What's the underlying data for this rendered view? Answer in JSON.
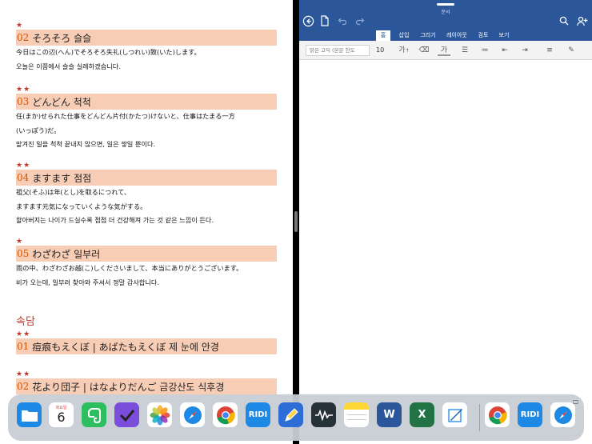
{
  "ebook": {
    "entries": [
      {
        "stars": "★",
        "num": "02",
        "title": "そろそろ 슬슬",
        "lines": [
          "今日はこの辺(へん)でそろそろ失礼(しつれい)致(いた)します。",
          "오늘은 이쯤에서 슬슬 실례하겠습니다."
        ]
      },
      {
        "stars": "★★",
        "num": "03",
        "title": "どんどん 척척",
        "lines": [
          "任(まか)せられた仕事をどんどん片付(かたつ)けないと、仕事はたまる一方",
          "(いっぽう)だ。",
          "맡겨진 일을 척척 끝내지 않으면, 일은 쌓일 뿐이다."
        ]
      },
      {
        "stars": "★★",
        "num": "04",
        "title": "ますます 점점",
        "lines": [
          "祖父(そふ)は年(とし)を取るにつれて、",
          "ますます元気になっていくような気がする。",
          "할아버지는 나이가 드실수록 점점 더 건강해져 가는 것 같은 느낌이 든다."
        ]
      },
      {
        "stars": "★",
        "num": "05",
        "title": "わざわざ 일부러",
        "lines": [
          "雨の中、わざわざお越(こ)しくださいまして、本当にありがとうございます。",
          "비가 오는데, 일부러 찾아와 주셔서 정말 감사합니다."
        ]
      }
    ],
    "section_title": "속담",
    "proverbs": [
      {
        "stars": "★★",
        "num": "01",
        "title": "痘痕もえくぼ | あばたもえくぼ 제 눈에 안경"
      },
      {
        "stars": "★★",
        "num": "02",
        "title": "花より団子 | はなよりだんご 금강산도 식후경"
      }
    ]
  },
  "word": {
    "doc_title": "문서",
    "tabs": [
      "홈",
      "삽입",
      "그리기",
      "레이아웃",
      "검토",
      "보기"
    ],
    "active_tab": "홈",
    "font_name": "맑은 고딕 (본문 한도",
    "font_size": "10",
    "colors": {
      "toolbar": "#2b579a"
    }
  },
  "dock": {
    "calendar_day": "화요일",
    "calendar_date": "6",
    "apps": [
      "files",
      "calendar",
      "evernote",
      "omnifocus",
      "photos",
      "safari",
      "chrome",
      "ridi",
      "pencil",
      "voice-memos",
      "notes",
      "word",
      "excel",
      "noteshelf",
      "chrome",
      "ridi",
      "safari"
    ]
  }
}
